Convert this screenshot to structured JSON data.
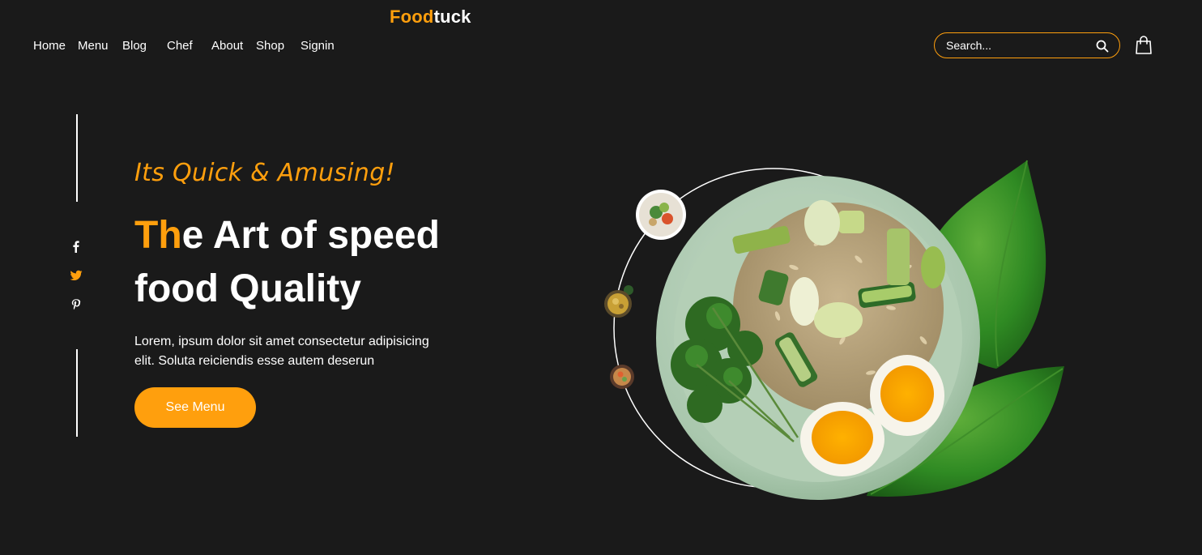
{
  "brand": {
    "accent": "Food",
    "rest": "tuck"
  },
  "nav": {
    "items": [
      {
        "label": "Home"
      },
      {
        "label": "Menu"
      },
      {
        "label": "Blog"
      },
      {
        "label": "Chef"
      },
      {
        "label": "About"
      },
      {
        "label": "Shop"
      },
      {
        "label": "Signin"
      }
    ]
  },
  "search": {
    "placeholder": "Search..."
  },
  "icons": {
    "search": "search-icon",
    "cart": "shopping-bag-icon",
    "social": [
      "facebook-icon",
      "twitter-icon",
      "pinterest-icon"
    ]
  },
  "hero": {
    "tagline": "Its Quick & Amusing!",
    "headline_accent": "Th",
    "headline_rest": "e Art of speed food Quality",
    "description": "Lorem, ipsum dolor sit amet consectetur adipisicing elit. Soluta reiciendis esse autem deserun",
    "cta_label": "See Menu"
  },
  "colors": {
    "background": "#1a1a1a",
    "accent": "#ff9f0d",
    "text": "#ffffff"
  }
}
